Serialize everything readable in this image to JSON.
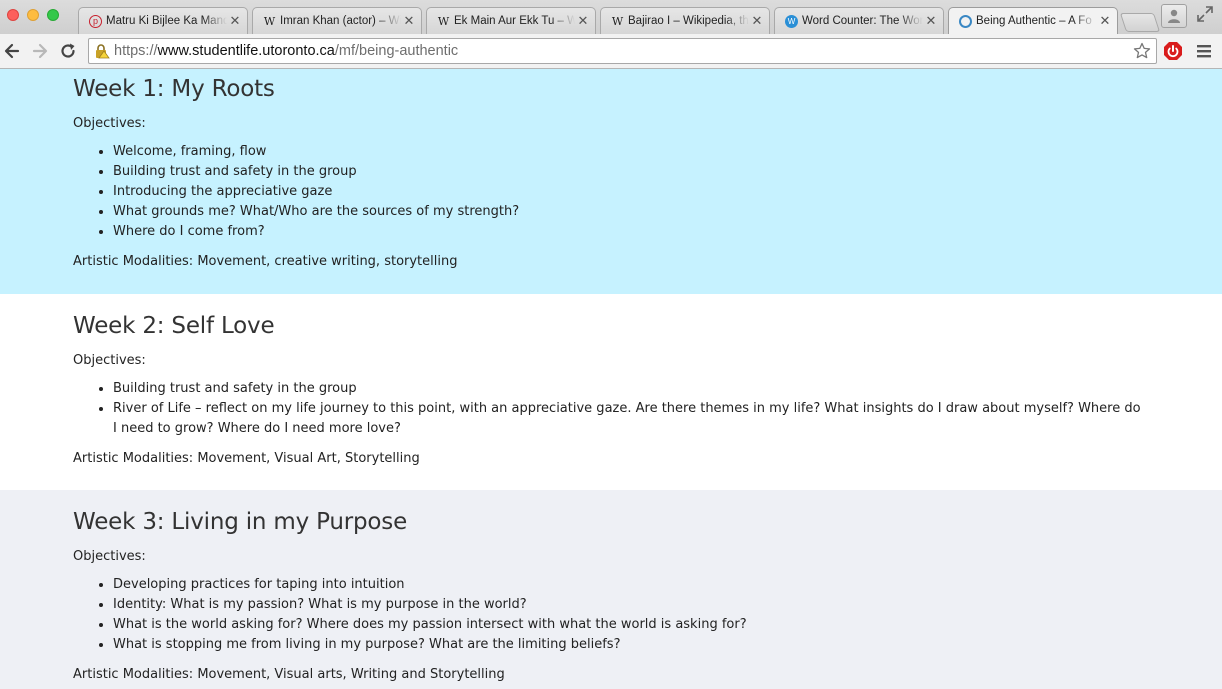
{
  "browser": {
    "tabs": [
      {
        "title": "Matru Ki Bijlee Ka Mandola",
        "icon": "pinterest-icon",
        "active": false
      },
      {
        "title": "Imran Khan (actor) – Wikipedia",
        "icon": "wikipedia-icon",
        "active": false
      },
      {
        "title": "Ek Main Aur Ekk Tu – Wikipedia",
        "icon": "wikipedia-icon",
        "active": false
      },
      {
        "title": "Bajirao I – Wikipedia, the free encyclopedia",
        "icon": "wikipedia-icon",
        "active": false
      },
      {
        "title": "Word Counter: The Word Count Tool",
        "icon": "word-counter-icon",
        "active": false
      },
      {
        "title": "Being Authentic – A Fo",
        "icon": "student-life-icon",
        "active": true
      }
    ],
    "url": {
      "scheme": "https://",
      "domain": "www.studentlife.utoronto.ca",
      "path": "/mf/being-authentic"
    }
  },
  "weeks": [
    {
      "title": "Week 1: My Roots",
      "objectives_label": "Objectives:",
      "objectives": [
        "Welcome, framing, flow",
        "Building trust and safety in the group",
        "Introducing the appreciative gaze",
        "What grounds me? What/Who are the sources of my strength?",
        "Where do I come from?"
      ],
      "modalities": "Artistic Modalities: Movement, creative writing, storytelling",
      "background": "#c6f2ff"
    },
    {
      "title": "Week 2: Self Love",
      "objectives_label": "Objectives:",
      "objectives": [
        "Building trust and safety in the group",
        "River of Life – reflect on my life journey to this point, with an appreciative gaze.  Are there themes in my life? What insights do I draw about myself?   Where do I need to grow? Where do I need more love?"
      ],
      "modalities": "Artistic Modalities: Movement, Visual Art, Storytelling",
      "background": "#ffffff"
    },
    {
      "title": "Week 3: Living in my Purpose",
      "objectives_label": "Objectives:",
      "objectives": [
        "Developing practices for taping into intuition",
        "Identity: What is my passion? What is my purpose in the world?",
        "What is the world asking for?  Where does my passion intersect with what the world is asking for?",
        "What is stopping me from living in my purpose? What are the limiting beliefs?"
      ],
      "modalities": "Artistic Modalities: Movement, Visual arts, Writing and Storytelling",
      "background": "#eef0f5"
    }
  ]
}
